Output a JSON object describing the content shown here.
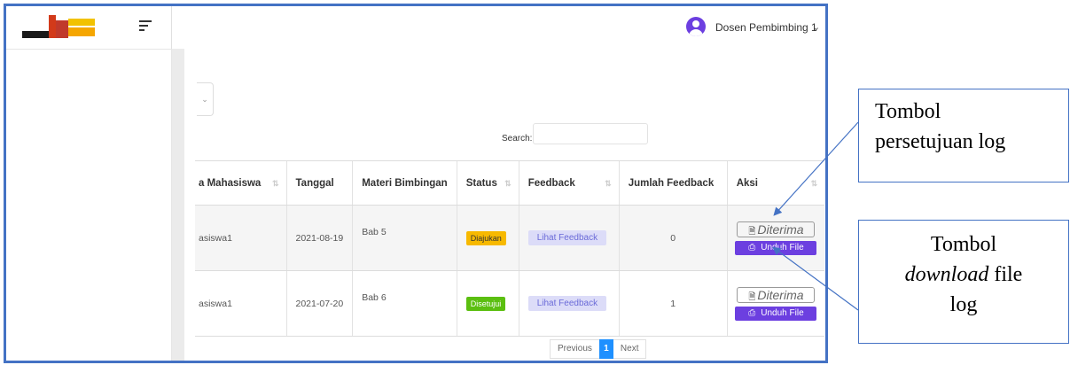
{
  "header": {
    "user_name": "Dosen Pembimbing 1",
    "caret": "⌄"
  },
  "search": {
    "label": "Search:",
    "placeholder": ""
  },
  "table": {
    "columns": [
      "a Mahasiswa",
      "Tanggal",
      "Materi Bimbingan",
      "Status",
      "Feedback",
      "Jumlah Feedback",
      "Aksi"
    ],
    "rows": [
      {
        "nama": "asiswa1",
        "tanggal": "2021-08-19",
        "materi": "Bab 5",
        "status": "Diajukan",
        "status_color": "#f7b900",
        "feedback": "Lihat Feedback",
        "jumlah": "0",
        "aksi_terima": "Diterima",
        "aksi_unduh": "Unduh File"
      },
      {
        "nama": "asiswa1",
        "tanggal": "2021-07-20",
        "materi": "Bab 6",
        "status": "Disetujui",
        "status_color": "#5bbf10",
        "feedback": "Lihat Feedback",
        "jumlah": "1",
        "aksi_terima": "Diterima",
        "aksi_unduh": "Unduh File"
      }
    ]
  },
  "pagination": {
    "previous": "Previous",
    "current": "1",
    "next": "Next"
  },
  "callouts": {
    "top": {
      "line1": "Tombol",
      "line2": "persetujuan log"
    },
    "bottom": {
      "line1": "Tombol",
      "line2_em": "download",
      "line2_rest": " file",
      "line3": "log"
    }
  },
  "colors": {
    "accent": "#6c3fe0",
    "frame": "#4472c4",
    "page_active": "#1e90ff"
  }
}
